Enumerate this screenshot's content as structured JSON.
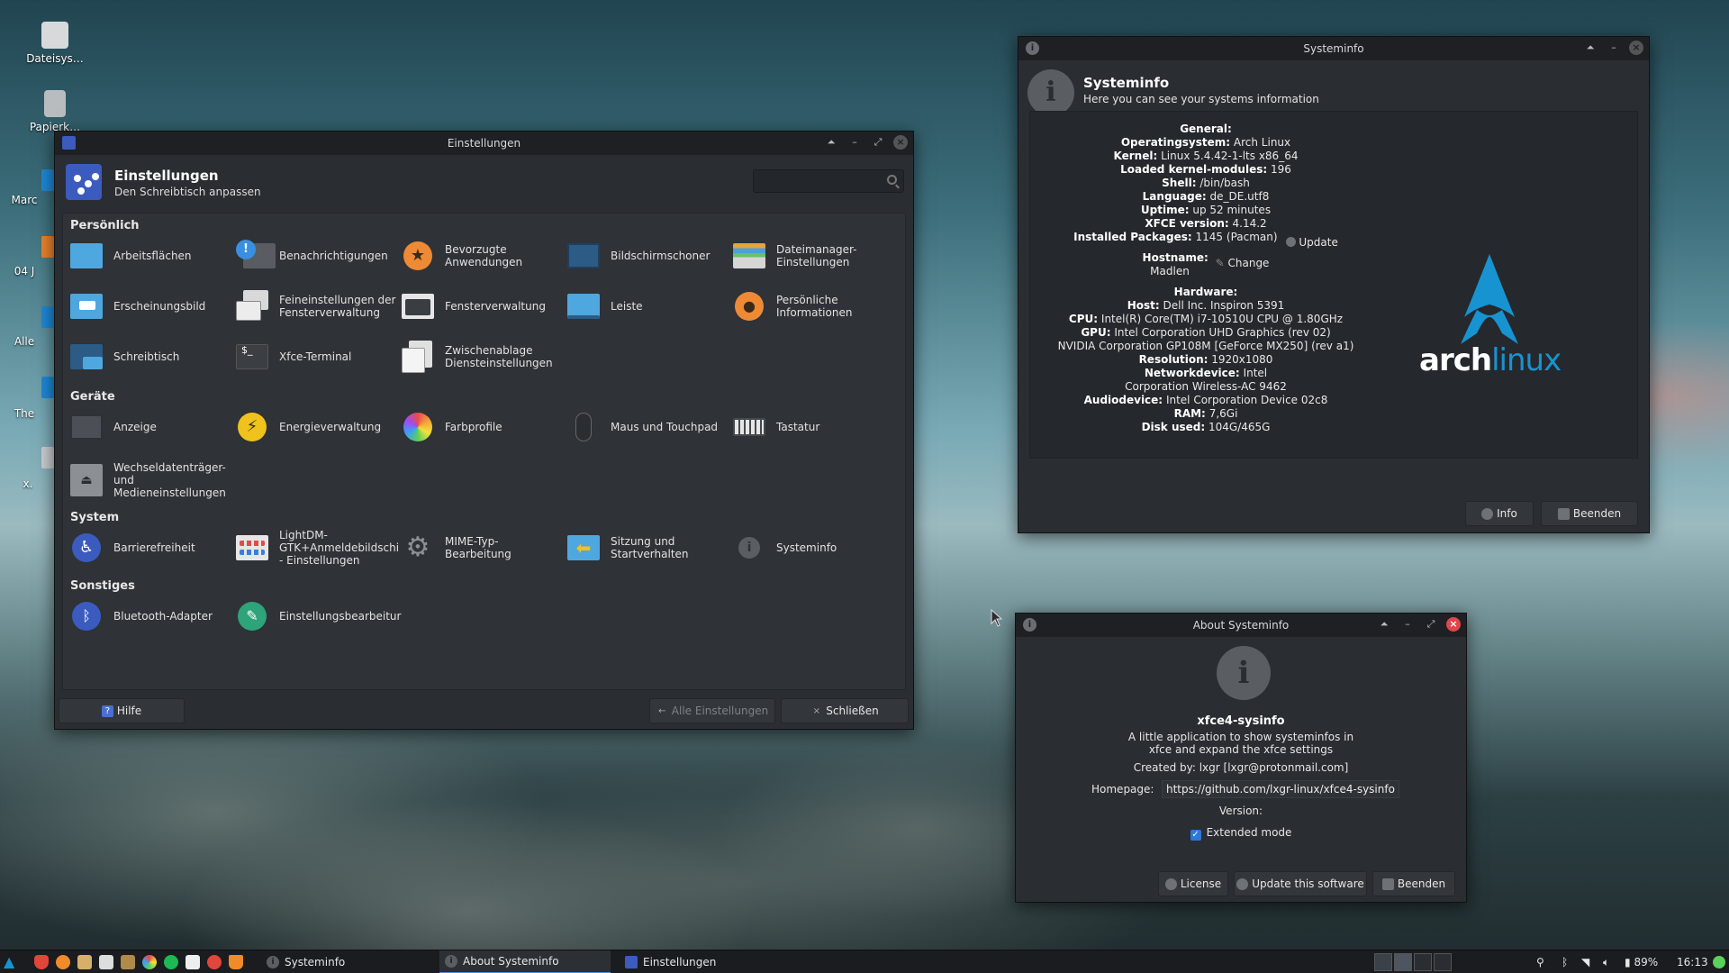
{
  "desktop": {
    "icons": [
      {
        "label": "Dateisys…",
        "icon": "drive-icon"
      },
      {
        "label": "Papierk…",
        "icon": "trash-icon"
      }
    ],
    "partial_labels": [
      "Marc",
      "04 J",
      "Alle",
      "The",
      "x."
    ]
  },
  "settings": {
    "window_title": "Einstellungen",
    "header_title": "Einstellungen",
    "header_subtitle": "Den Schreibtisch anpassen",
    "search_placeholder": "",
    "categories": {
      "personal": "Persönlich",
      "devices": "Geräte",
      "system": "System",
      "other": "Sonstiges"
    },
    "items": {
      "arbeitsflaechen": "Arbeitsflächen",
      "benachrichtigungen": "Benachrichtigungen",
      "bevorzugte_1": "Bevorzugte",
      "bevorzugte_2": "Anwendungen",
      "bildschirmschoner": "Bildschirmschoner",
      "dateimanager_1": "Dateimanager-",
      "dateimanager_2": "Einstellungen",
      "erscheinungsbild": "Erscheinungsbild",
      "feineinstellungen_1": "Feineinstellungen der",
      "feineinstellungen_2": "Fensterverwaltung",
      "fensterverwaltung": "Fensterverwaltung",
      "leiste": "Leiste",
      "persoenliche_1": "Persönliche",
      "persoenliche_2": "Informationen",
      "schreibtisch": "Schreibtisch",
      "xfce_terminal": "Xfce-Terminal",
      "zwischenablage_1": "Zwischenablage",
      "zwischenablage_2": "Diensteinstellungen",
      "anzeige": "Anzeige",
      "energieverwaltung": "Energieverwaltung",
      "farbprofile": "Farbprofile",
      "maus": "Maus und Touchpad",
      "tastatur": "Tastatur",
      "wechsel_1": "Wechseldatenträger-",
      "wechsel_2": "und",
      "wechsel_3": "Medieneinstellungen",
      "barrierefreiheit": "Barrierefreiheit",
      "lightdm_1": "LightDM-",
      "lightdm_2": "GTK+Anmeldebildschi",
      "lightdm_3": "- Einstellungen",
      "mime_1": "MIME-Typ-",
      "mime_2": "Bearbeitung",
      "sitzung_1": "Sitzung und",
      "sitzung_2": "Startverhalten",
      "systeminfo": "Systeminfo",
      "bluetooth": "Bluetooth-Adapter",
      "einstellungsbearbeitung": "Einstellungsbearbeitur"
    },
    "buttons": {
      "help": "Hilfe",
      "all_settings": "Alle Einstellungen",
      "close": "Schließen"
    }
  },
  "sysinfo": {
    "window_title": "Systeminfo",
    "header_title": "Systeminfo",
    "header_subtitle": "Here you can see your systems information",
    "general_label": "General:",
    "rows": {
      "os_k": "Operatingsystem:",
      "os_v": "Arch Linux",
      "kernel_k": "Kernel:",
      "kernel_v": "Linux 5.4.42-1-lts x86_64",
      "modules_k": "Loaded kernel-modules:",
      "modules_v": "196",
      "shell_k": "Shell:",
      "shell_v": "/bin/bash",
      "lang_k": "Language:",
      "lang_v": "de_DE.utf8",
      "uptime_k": "Uptime:",
      "uptime_v": "up 52 minutes",
      "xfce_k": "XFCE version:",
      "xfce_v": "4.14.2",
      "pkg_k": "Installed Packages:",
      "pkg_v": "1145 (Pacman)",
      "update": "Update",
      "host_k": "Hostname:",
      "host_v": "Madlen",
      "change": "Change",
      "hardware_label": "Hardware:",
      "hw_host_k": "Host:",
      "hw_host_v": "Dell Inc. Inspiron 5391",
      "cpu_k": "CPU:",
      "cpu_v": "Intel(R) Core(TM) i7-10510U CPU @ 1.80GHz",
      "gpu_k": "GPU:",
      "gpu_v": "Intel Corporation UHD Graphics (rev 02)",
      "gpu2": "NVIDIA Corporation GP108M [GeForce MX250] (rev a1)",
      "res_k": "Resolution:",
      "res_v": "1920x1080",
      "net_k": "Networkdevice:",
      "net_v": "Intel",
      "net2": "Corporation Wireless-AC 9462",
      "audio_k": "Audiodevice:",
      "audio_v": "Intel Corporation Device 02c8",
      "ram_k": "RAM:",
      "ram_v": "7,6Gi",
      "disk_k": "Disk used:",
      "disk_v": "104G/465G"
    },
    "logo_text_a": "arch",
    "logo_text_b": "linux",
    "buttons": {
      "info": "Info",
      "quit": "Beenden"
    }
  },
  "about": {
    "window_title": "About Systeminfo",
    "app_name": "xfce4-sysinfo",
    "desc_1": "A little application to show systeminfos in",
    "desc_2": "xfce and expand the xfce settings",
    "created_by": "Created by: lxgr [lxgr@protonmail.com]",
    "homepage_label": "Homepage:",
    "homepage_url": "https://github.com/lxgr-linux/xfce4-sysinfo",
    "version_label": "Version:",
    "extended_mode": "Extended mode",
    "extended_checked": true,
    "buttons": {
      "license": "License",
      "update": "Update this software",
      "quit": "Beenden"
    }
  },
  "taskbar": {
    "tasks": [
      {
        "label": "Systeminfo",
        "active": false
      },
      {
        "label": "About Systeminfo",
        "active": true
      },
      {
        "label": "Einstellungen",
        "active": false
      }
    ],
    "battery": "89%",
    "clock": "16:13"
  },
  "colors": {
    "accent": "#4a8fd8",
    "arch_blue": "#1793d1",
    "close_red": "#e0464b"
  }
}
